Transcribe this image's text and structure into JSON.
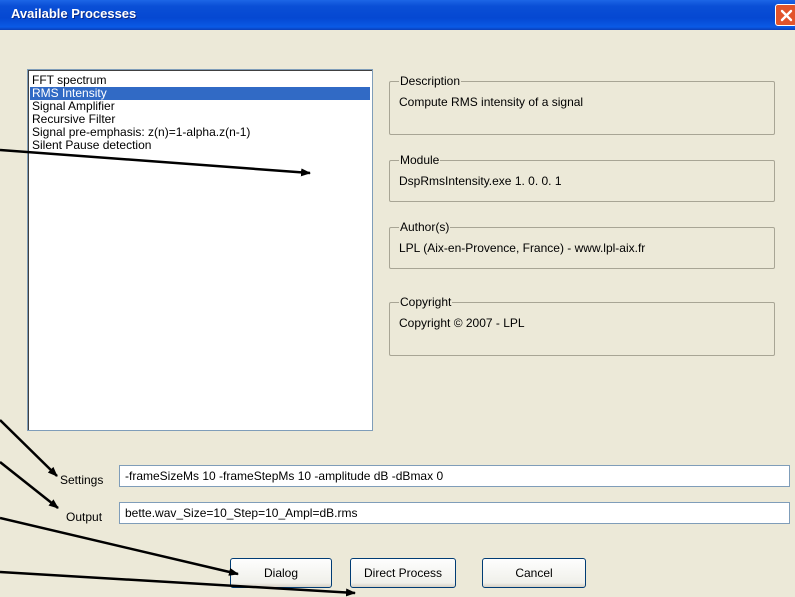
{
  "window": {
    "title": "Available Processes"
  },
  "process_list": {
    "items": [
      {
        "label": "FFT spectrum",
        "selected": false
      },
      {
        "label": "RMS Intensity",
        "selected": true
      },
      {
        "label": "Signal Amplifier",
        "selected": false
      },
      {
        "label": "Recursive Filter",
        "selected": false
      },
      {
        "label": "Signal pre-emphasis: z(n)=1-alpha.z(n-1)",
        "selected": false
      },
      {
        "label": "Silent Pause detection",
        "selected": false
      }
    ]
  },
  "details": {
    "description": {
      "legend": "Description",
      "value": "Compute RMS intensity of a signal"
    },
    "module": {
      "legend": "Module",
      "value": "DspRmsIntensity.exe 1. 0. 0. 1"
    },
    "authors": {
      "legend": "Author(s)",
      "value": "LPL (Aix-en-Provence, France) - www.lpl-aix.fr"
    },
    "copyright": {
      "legend": "Copyright",
      "value": "Copyright © 2007 - LPL"
    }
  },
  "settings": {
    "label": "Settings",
    "value": "-frameSizeMs 10 -frameStepMs 10 -amplitude dB -dBmax 0"
  },
  "output": {
    "label": "Output",
    "value": "bette.wav_Size=10_Step=10_Ampl=dB.rms"
  },
  "buttons": {
    "dialog": "Dialog",
    "direct_process": "Direct Process",
    "cancel": "Cancel"
  },
  "icons": {
    "close": "close-icon"
  },
  "colors": {
    "titlebar": "#0548d2",
    "selection": "#316ac5",
    "close": "#e2542b",
    "dialog_bg": "#ece9d8"
  }
}
